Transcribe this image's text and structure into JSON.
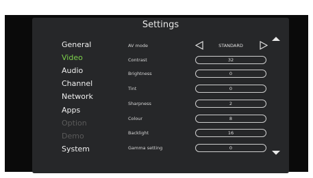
{
  "title": "Settings",
  "menu": [
    {
      "label": "General",
      "state": "normal"
    },
    {
      "label": "Video",
      "state": "selected"
    },
    {
      "label": "Audio",
      "state": "normal"
    },
    {
      "label": "Channel",
      "state": "normal"
    },
    {
      "label": "Network",
      "state": "normal"
    },
    {
      "label": "Apps",
      "state": "normal"
    },
    {
      "label": "Option",
      "state": "disabled"
    },
    {
      "label": "Demo",
      "state": "disabled"
    },
    {
      "label": "System",
      "state": "normal"
    }
  ],
  "av_mode": {
    "label": "AV mode",
    "value": "STANDARD"
  },
  "settings": [
    {
      "label": "Contrast",
      "value": "32"
    },
    {
      "label": "Brightness",
      "value": "0"
    },
    {
      "label": "Tint",
      "value": "0"
    },
    {
      "label": "Sharpness",
      "value": "2"
    },
    {
      "label": "Colour",
      "value": "8"
    },
    {
      "label": "Backlight",
      "value": "16"
    },
    {
      "label": "Gamma setting",
      "value": "0"
    }
  ],
  "colors": {
    "selected": "#7cd04b",
    "disabled": "#5a5a5a",
    "panel": "#262729"
  },
  "icons": {
    "prev": "triangle-left-icon",
    "next": "triangle-right-icon",
    "scroll_up": "triangle-up-icon",
    "scroll_down": "triangle-down-icon"
  }
}
